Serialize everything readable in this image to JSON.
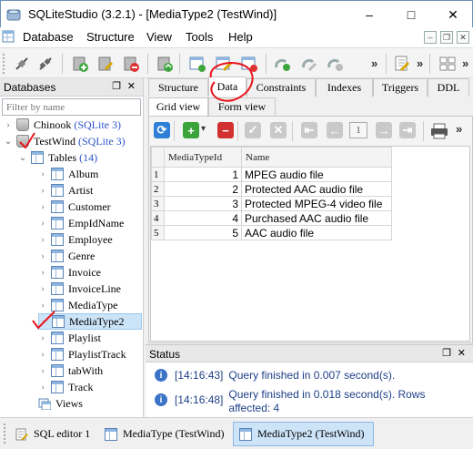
{
  "window": {
    "title": "SQLiteStudio (3.2.1) - [MediaType2 (TestWind)]",
    "controls": [
      "–",
      "□",
      "✕"
    ]
  },
  "menu": {
    "items": [
      "Database",
      "Structure",
      "View",
      "Tools",
      "Help"
    ]
  },
  "db_panel": {
    "header": "Databases",
    "filter_placeholder": "Filter by name",
    "databases": [
      {
        "name": "Chinook",
        "badge": "(SQLite 3)"
      },
      {
        "name": "TestWind",
        "badge": "(SQLite 3)"
      }
    ],
    "tables_label": "Tables",
    "tables_count": "(14)",
    "tables": [
      "Album",
      "Artist",
      "Customer",
      "EmpIdName",
      "Employee",
      "Genre",
      "Invoice",
      "InvoiceLine",
      "MediaType",
      "MediaType2",
      "Playlist",
      "PlaylistTrack",
      "tabWith",
      "Track"
    ],
    "views_label": "Views",
    "selected_table": "MediaType2"
  },
  "editor_tabs": [
    "Structure",
    "Data",
    "Constraints",
    "Indexes",
    "Triggers",
    "DDL"
  ],
  "active_editor_tab": "Data",
  "view_tabs": [
    "Grid view",
    "Form view"
  ],
  "active_view_tab": "Grid view",
  "pager": {
    "page": "1"
  },
  "grid": {
    "columns": [
      "MediaTypeId",
      "Name"
    ],
    "rows": [
      {
        "n": "1",
        "id": "1",
        "name": "MPEG audio file"
      },
      {
        "n": "2",
        "id": "2",
        "name": "Protected AAC audio file"
      },
      {
        "n": "3",
        "id": "3",
        "name": "Protected MPEG-4 video file"
      },
      {
        "n": "4",
        "id": "4",
        "name": "Purchased AAC audio file"
      },
      {
        "n": "5",
        "id": "5",
        "name": "AAC audio file"
      }
    ]
  },
  "status": {
    "header": "Status",
    "messages": [
      {
        "time": "[14:16:43]",
        "text": "Query finished in 0.007 second(s)."
      },
      {
        "time": "[14:16:48]",
        "text": "Query finished in 0.018 second(s). Rows affected: 4"
      }
    ]
  },
  "bottom_tabs": [
    "SQL editor 1",
    "MediaType (TestWind)",
    "MediaType2 (TestWind)"
  ],
  "active_bottom_tab": "MediaType2 (TestWind)",
  "colors": {
    "accent": "#2c55c9",
    "annotation": "#e8141c",
    "selection": "#cde3f7"
  }
}
